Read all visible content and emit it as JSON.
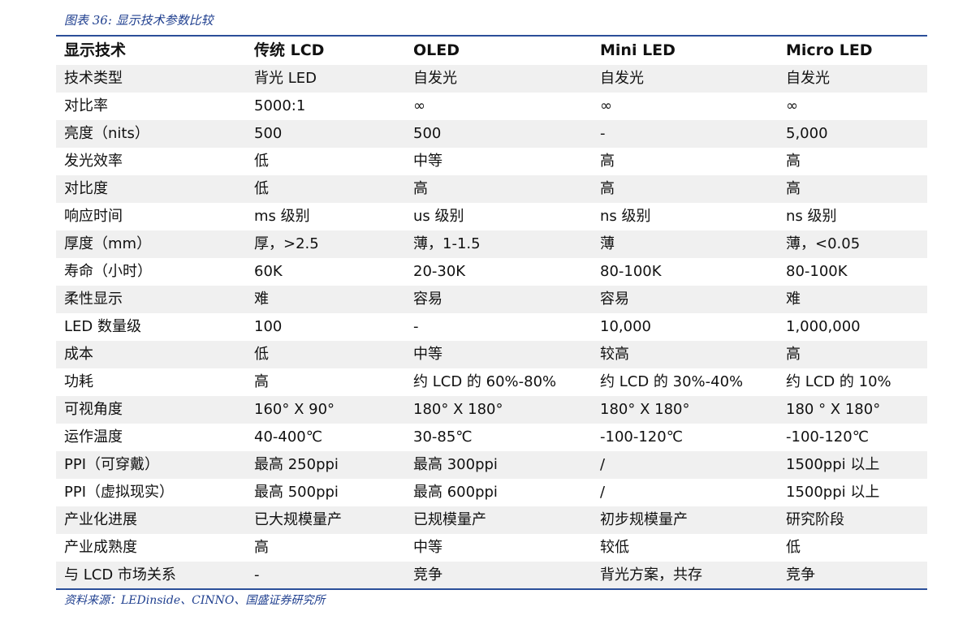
{
  "caption": "图表 36:  显示技术参数比较",
  "headers": [
    "显示技术",
    "传统 LCD",
    "OLED",
    "Mini LED",
    "Micro LED"
  ],
  "rows": [
    [
      "技术类型",
      "背光 LED",
      "自发光",
      "自发光",
      "自发光"
    ],
    [
      "对比率",
      "5000:1",
      "∞",
      "∞",
      "∞"
    ],
    [
      "亮度（nits）",
      "500",
      "500",
      "-",
      "5,000"
    ],
    [
      "发光效率",
      "低",
      "中等",
      "高",
      "高"
    ],
    [
      "对比度",
      "低",
      "高",
      "高",
      "高"
    ],
    [
      "响应时间",
      "ms 级别",
      "us 级别",
      "ns 级别",
      "ns 级别"
    ],
    [
      "厚度（mm）",
      "厚，>2.5",
      "薄，1-1.5",
      "薄",
      "薄，<0.05"
    ],
    [
      "寿命（小时）",
      "60K",
      "20-30K",
      "80-100K",
      "80-100K"
    ],
    [
      "柔性显示",
      "难",
      "容易",
      "容易",
      "难"
    ],
    [
      "LED 数量级",
      "100",
      "-",
      "10,000",
      "1,000,000"
    ],
    [
      "成本",
      "低",
      "中等",
      "较高",
      "高"
    ],
    [
      "功耗",
      "高",
      "约 LCD 的 60%-80%",
      "约 LCD 的 30%-40%",
      "约 LCD 的 10%"
    ],
    [
      "可视角度",
      "160° X 90°",
      "180° X 180°",
      "180° X 180°",
      "180 ° X 180°"
    ],
    [
      "运作温度",
      "40-400℃",
      "30-85℃",
      "-100-120℃",
      "-100-120℃"
    ],
    [
      "PPI（可穿戴）",
      "最高 250ppi",
      "最高 300ppi",
      "/",
      "1500ppi 以上"
    ],
    [
      "PPI（虚拟现实）",
      "最高 500ppi",
      "最高 600ppi",
      "/",
      "1500ppi 以上"
    ],
    [
      "产业化进展",
      "已大规模量产",
      "已规模量产",
      "初步规模量产",
      "研究阶段"
    ],
    [
      "产业成熟度",
      "高",
      "中等",
      "较低",
      "低"
    ],
    [
      "与 LCD 市场关系",
      "-",
      "竞争",
      "背光方案，共存",
      "竞争"
    ]
  ],
  "source": "资料来源：LEDinside、CINNO、国盛证券研究所"
}
